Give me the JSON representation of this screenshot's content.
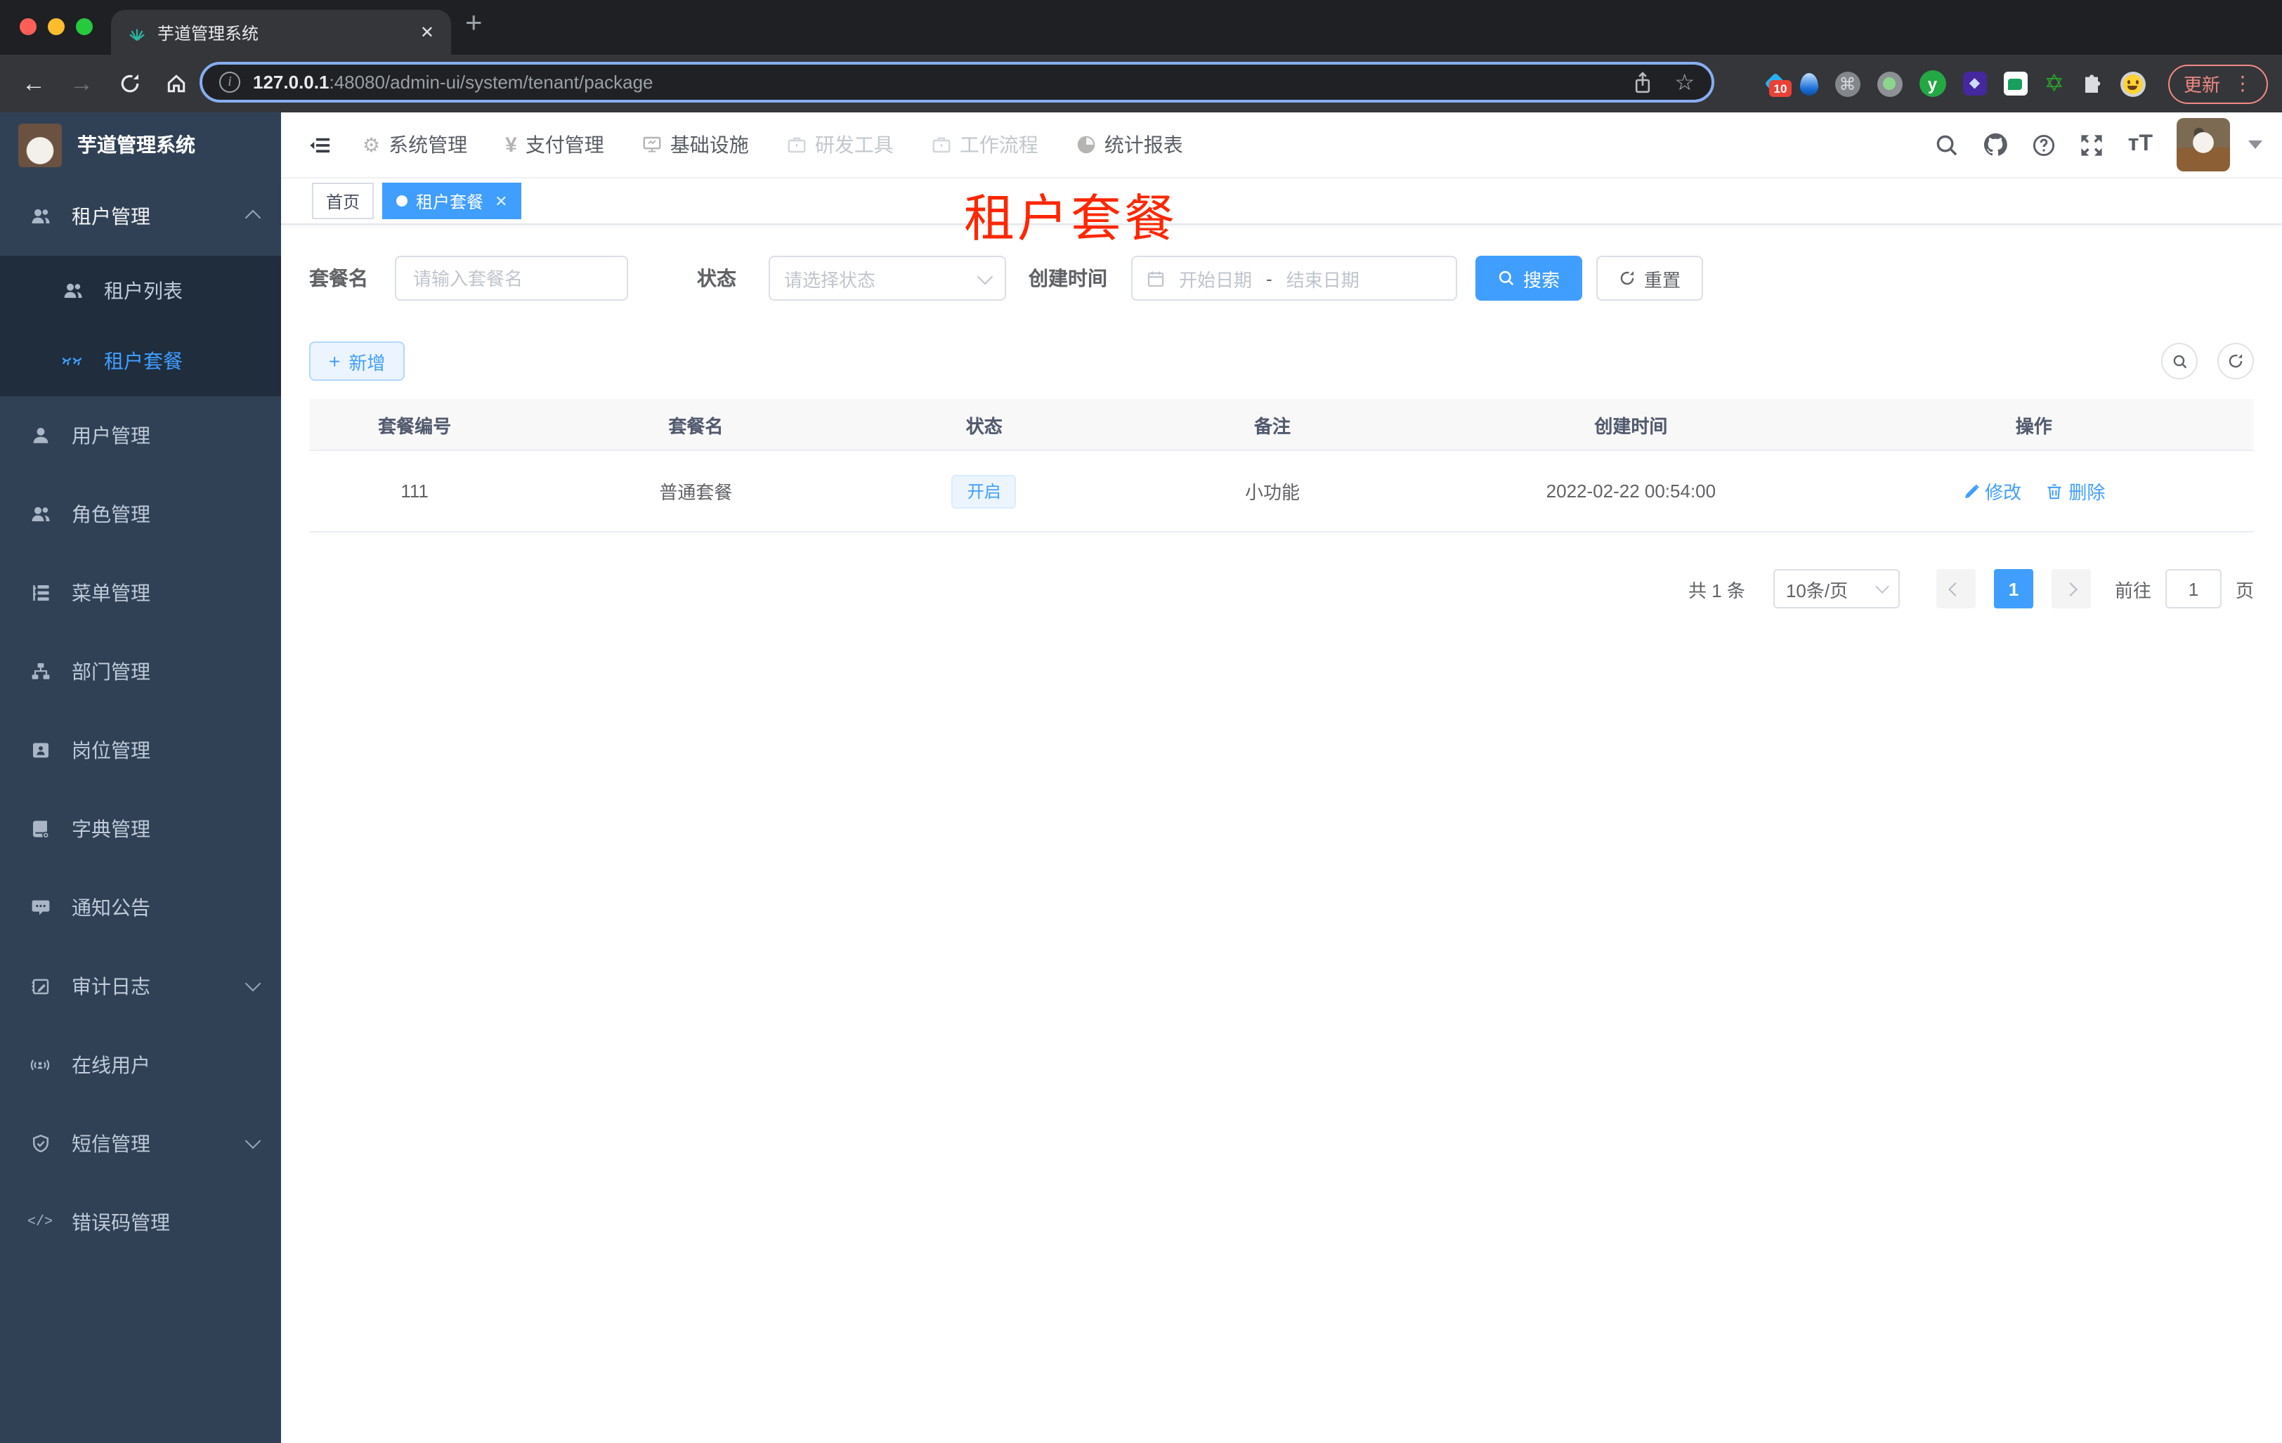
{
  "browser": {
    "tab_title": "芋道管理系统",
    "close_glyph": "✕",
    "new_tab_glyph": "+",
    "url": {
      "host": "127.0.0.1",
      "rest": ":48080/admin-ui/system/tenant/package"
    },
    "back_glyph": "←",
    "forward_glyph": "→",
    "star_glyph": "☆",
    "ext_badge": "10",
    "cmd_glyph": "⌘",
    "y_ext_glyph": "y",
    "shield_ext_glyph": "◆",
    "star_ext_glyph": "✡",
    "update_label": "更新",
    "menu_dots": "⋮"
  },
  "header": {
    "menu": [
      {
        "label": "系统管理"
      },
      {
        "label": "支付管理"
      },
      {
        "label": "基础设施"
      },
      {
        "label": "研发工具"
      },
      {
        "label": "工作流程"
      },
      {
        "label": "统计报表"
      }
    ],
    "yen_glyph": "¥",
    "gear_glyph": "⚙"
  },
  "sidebar": {
    "title": "芋道管理系统",
    "items": [
      {
        "label": "租户管理"
      },
      {
        "label": "租户列表"
      },
      {
        "label": "租户套餐"
      },
      {
        "label": "用户管理"
      },
      {
        "label": "角色管理"
      },
      {
        "label": "菜单管理"
      },
      {
        "label": "部门管理"
      },
      {
        "label": "岗位管理"
      },
      {
        "label": "字典管理"
      },
      {
        "label": "通知公告"
      },
      {
        "label": "审计日志"
      },
      {
        "label": "在线用户"
      },
      {
        "label": "短信管理"
      },
      {
        "label": "错误码管理"
      }
    ],
    "code_glyph": "</>"
  },
  "tags": {
    "home": "首页",
    "active": "租户套餐",
    "close_glyph": "✕"
  },
  "annotation": {
    "text": "租户套餐",
    "color": "#ff2600"
  },
  "filters": {
    "name_label": "套餐名",
    "name_placeholder": "请输入套餐名",
    "status_label": "状态",
    "status_placeholder": "请选择状态",
    "date_label": "创建时间",
    "date_start": "开始日期",
    "date_separator": "-",
    "date_end": "结束日期",
    "search_label": "搜索",
    "reset_label": "重置"
  },
  "toolbar": {
    "add_label": "新增",
    "plus_glyph": "+"
  },
  "table": {
    "headers": [
      "套餐编号",
      "套餐名",
      "状态",
      "备注",
      "创建时间",
      "操作"
    ],
    "rows": [
      {
        "id": "111",
        "name": "普通套餐",
        "status": "开启",
        "remark": "小功能",
        "created": "2022-02-22 00:54:00",
        "edit_label": "修改",
        "delete_label": "删除"
      }
    ]
  },
  "pagination": {
    "total": "共 1 条",
    "page_size": "10条/页",
    "current_page": "1",
    "goto_label": "前往",
    "goto_value": "1",
    "page_suffix": "页"
  },
  "colors": {
    "primary": "#409eff",
    "sidebar_bg": "#304156",
    "submenu_bg": "#1f2d3d",
    "annotation": "#ff2600",
    "tag_open_bg": "#ecf5ff"
  }
}
